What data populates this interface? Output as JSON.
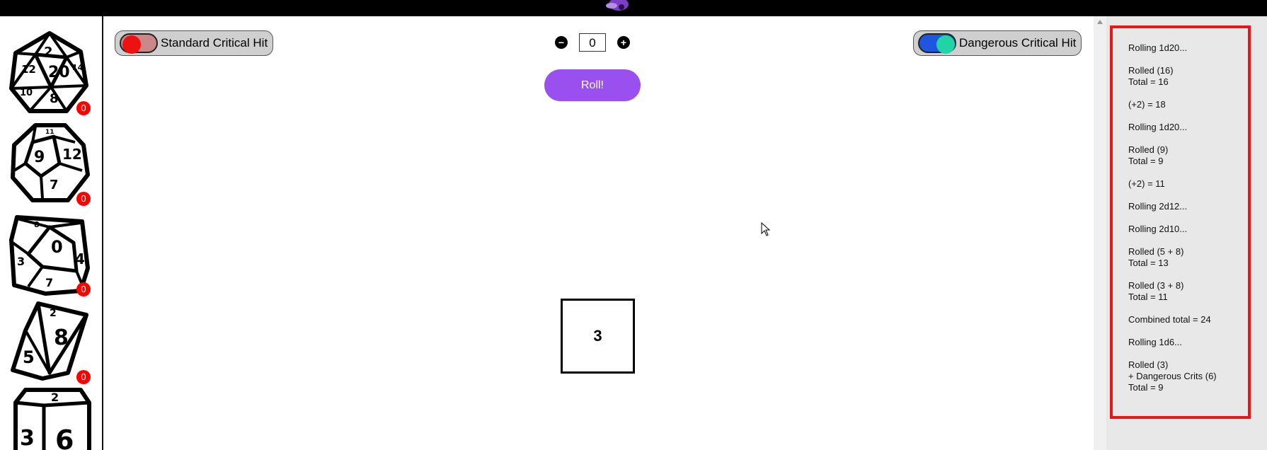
{
  "toggles": {
    "standard": {
      "label": "Standard Critical Hit",
      "enabled": false,
      "knob_color": "#ee1111",
      "track_color": "#c98787"
    },
    "dangerous": {
      "label": "Dangerous Critical Hit",
      "enabled": true,
      "knob_color": "#20d4a6",
      "track_color": "#1e56e0"
    }
  },
  "modifier": {
    "value": "0",
    "minus_icon": "minus-circle-icon",
    "plus_icon": "plus-circle-icon"
  },
  "roll_button": {
    "label": "Roll!"
  },
  "result": {
    "value": "3"
  },
  "dice": [
    {
      "name": "d20",
      "count": "0",
      "faces": [
        "2",
        "20",
        "14",
        "8",
        "10",
        "12"
      ]
    },
    {
      "name": "d12",
      "count": "0",
      "faces": [
        "9",
        "12",
        "7",
        "11"
      ]
    },
    {
      "name": "d10",
      "count": "0",
      "faces": [
        "0",
        "4",
        "8",
        "3",
        "7"
      ]
    },
    {
      "name": "d8",
      "count": "0",
      "faces": [
        "8",
        "5",
        "2"
      ]
    },
    {
      "name": "d6",
      "count": "",
      "faces": [
        "3",
        "6",
        "2"
      ]
    }
  ],
  "log": [
    [
      "Rolling 1d20..."
    ],
    [
      "Rolled (16)",
      "Total = 16"
    ],
    [
      "(+2) = 18"
    ],
    [
      "Rolling 1d20..."
    ],
    [
      "Rolled (9)",
      "Total = 9"
    ],
    [
      "(+2) = 11"
    ],
    [
      "Rolling 2d12..."
    ],
    [
      "Rolling 2d10..."
    ],
    [
      "Rolled (5 + 8)",
      "Total = 13"
    ],
    [
      "Rolled (3 + 8)",
      "Total = 11"
    ],
    [
      "Combined total = 24"
    ],
    [
      "Rolling 1d6..."
    ],
    [
      "Rolled (3)",
      "+ Dangerous Crits (6)",
      "Total = 9"
    ]
  ],
  "colors": {
    "accent": "#9a4fef",
    "badge": "#ff0000",
    "log_border": "#e81616"
  }
}
